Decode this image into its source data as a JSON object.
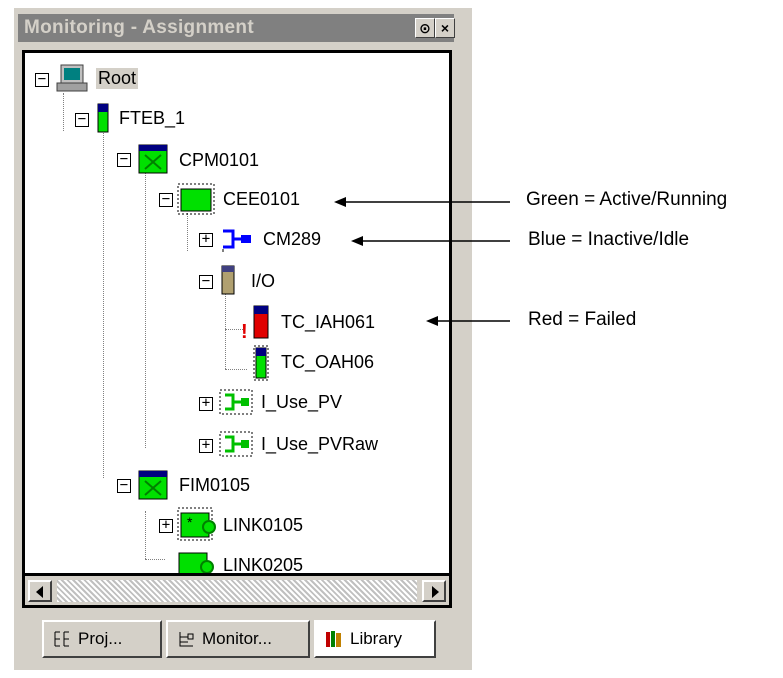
{
  "window": {
    "title": "Monitoring - Assignment",
    "pin_glyph": "⊙",
    "close_glyph": "×"
  },
  "tree": {
    "root": "Root",
    "fteb": "FTEB_1",
    "cpm": "CPM0101",
    "cee": "CEE0101",
    "cm289": "CM289",
    "io": "I/O",
    "tc_iah": "TC_IAH061",
    "tc_oah": "TC_OAH06",
    "use_pv": "I_Use_PV",
    "use_pvraw": "I_Use_PVRaw",
    "fim": "FIM0105",
    "link1": "LINK0105",
    "link2": "LINK0205",
    "expand_minus": "−",
    "expand_plus": "+",
    "fail_mark": "!"
  },
  "tabs": [
    {
      "label": "Proj..."
    },
    {
      "label": "Monitor..."
    },
    {
      "label": "Library"
    }
  ],
  "annotations": {
    "green": "Green = Active/Running",
    "blue": "Blue = Inactive/Idle",
    "red": "Red = Failed"
  },
  "colors": {
    "active": "#00e000",
    "inactive": "#0000ff",
    "failed": "#e00000",
    "titlebar": "#808080"
  },
  "icons": {
    "root": "computer-icon",
    "fteb": "controller-module-icon",
    "cpm": "processor-icon",
    "cee": "execution-environment-icon",
    "cm": "control-module-icon",
    "io": "io-module-icon",
    "link": "link-icon"
  }
}
